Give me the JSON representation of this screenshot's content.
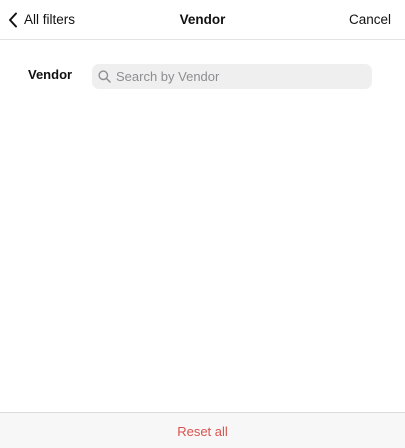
{
  "header": {
    "back_label": "All filters",
    "title": "Vendor",
    "cancel_label": "Cancel"
  },
  "filter": {
    "label": "Vendor",
    "search": {
      "placeholder": "Search by Vendor",
      "value": ""
    }
  },
  "footer": {
    "reset_label": "Reset all"
  },
  "colors": {
    "reset_text": "#d9534f",
    "search_background": "#efefef",
    "footer_background": "#f7f7f7"
  },
  "icons": {
    "back": "chevron-left-icon",
    "search": "search-icon"
  }
}
